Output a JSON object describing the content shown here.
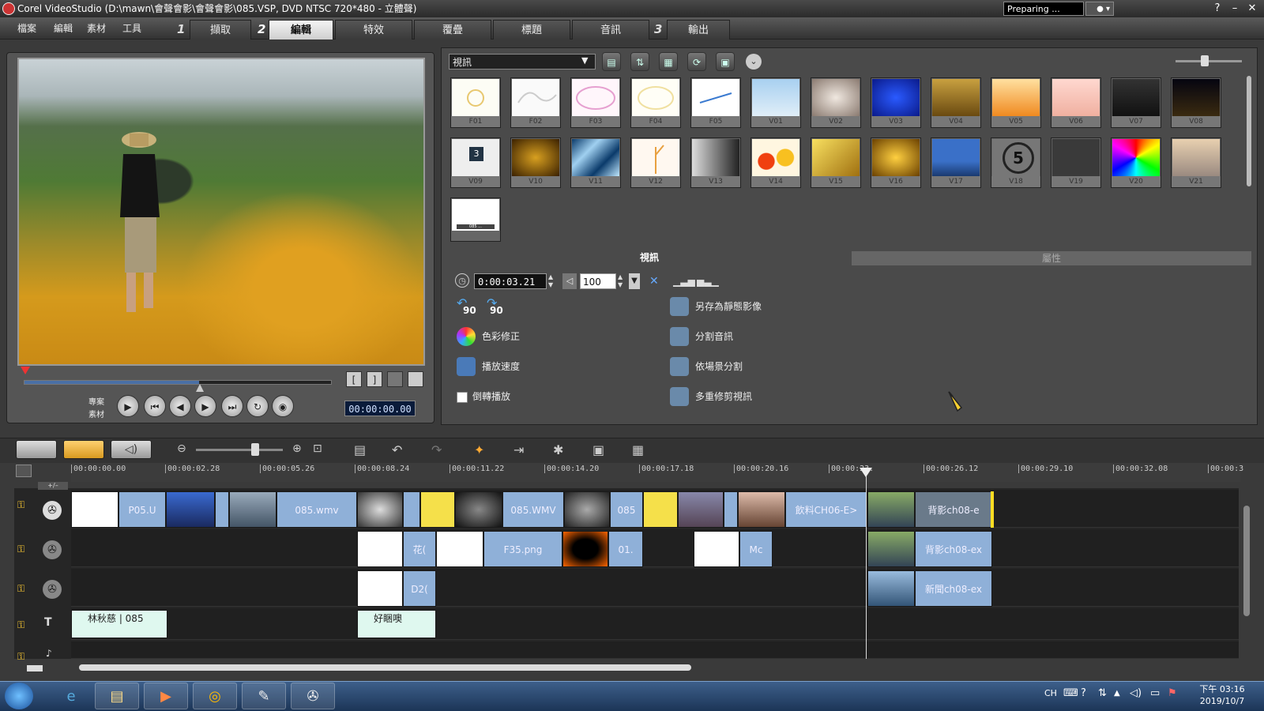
{
  "window": {
    "title": "Corel VideoStudio (D:\\mawn\\會聲會影\\會聲會影\\085.VSP, DVD NTSC 720*480 - 立體聲)",
    "status_combo": "Preparing ...",
    "help": "?",
    "minimize": "–",
    "close": "✕"
  },
  "menu": {
    "items": [
      "檔案",
      "編輯",
      "素材",
      "工具"
    ],
    "steps": [
      {
        "num": "1",
        "label": "擷取"
      },
      {
        "num": "2",
        "label": "編輯"
      },
      {
        "label": "特效"
      },
      {
        "label": "覆疊"
      },
      {
        "label": "標題"
      },
      {
        "label": "音訊"
      },
      {
        "num": "3",
        "label": "輸出"
      }
    ]
  },
  "preview": {
    "mode_project": "專案",
    "mode_clip": "素材",
    "timecode": "00:00:00.00",
    "scrub_progress": 0.57
  },
  "library": {
    "category": "視訊",
    "row1": [
      "F01",
      "F02",
      "F03",
      "F04",
      "F05",
      "V01",
      "V02",
      "V03",
      "V04",
      "V05",
      "V06",
      "V07",
      "V08"
    ],
    "row2": [
      "V09",
      "V10",
      "V11",
      "V12",
      "V13",
      "V14",
      "V15",
      "V16",
      "V17",
      "V18",
      "V19",
      "V20",
      "V21"
    ],
    "extra_thumb_label": "085 ...",
    "v18_number": "5",
    "v09_number": "3"
  },
  "options": {
    "tab_video": "視訊",
    "tab_attributes": "屬性",
    "duration": "0:00:03.21",
    "volume": "100",
    "rotate_left": "90",
    "rotate_right": "90",
    "color_correction": "色彩修正",
    "playback_speed": "播放速度",
    "reverse_playback": "倒轉播放",
    "save_as_still": "另存為靜態影像",
    "split_audio": "分割音訊",
    "split_by_scene": "依場景分割",
    "multi_trim": "多重修剪視訊"
  },
  "timeline": {
    "ruler": [
      "00:00:00.00",
      "00:00:02.28",
      "00:00:05.26",
      "00:00:08.24",
      "00:00:11.22",
      "00:00:14.20",
      "00:00:17.18",
      "00:00:20.16",
      "00:00:23.",
      "00:00:26.12",
      "00:00:29.10",
      "00:00:32.08",
      "00:00:3"
    ],
    "video_clips": {
      "c1": "P05.U",
      "c2": "085.wmv",
      "c3": "085.WMV",
      "c4": "085",
      "c5": "飲料CH06-E>",
      "c6": "背影ch08-e"
    },
    "overlay1_clips": {
      "c1": "花(",
      "c2": "F35.png",
      "c3": "01.",
      "c4": "Mc",
      "c5": "背影ch08-ex"
    },
    "overlay2_clips": {
      "c1": "D2(",
      "c2": "新聞ch08-ex"
    },
    "title_clips": {
      "c1": "林秋慈 | 085",
      "c2": "好睏噢"
    },
    "title_track_label": "T",
    "add_track": "+/–"
  },
  "taskbar": {
    "lang": "CH",
    "time": "下午 03:16",
    "date": "2019/10/7"
  },
  "colors": {
    "accent_blue": "#8fb0d8",
    "title_clip": "#dff8ef",
    "panel": "#4a4a4a"
  }
}
